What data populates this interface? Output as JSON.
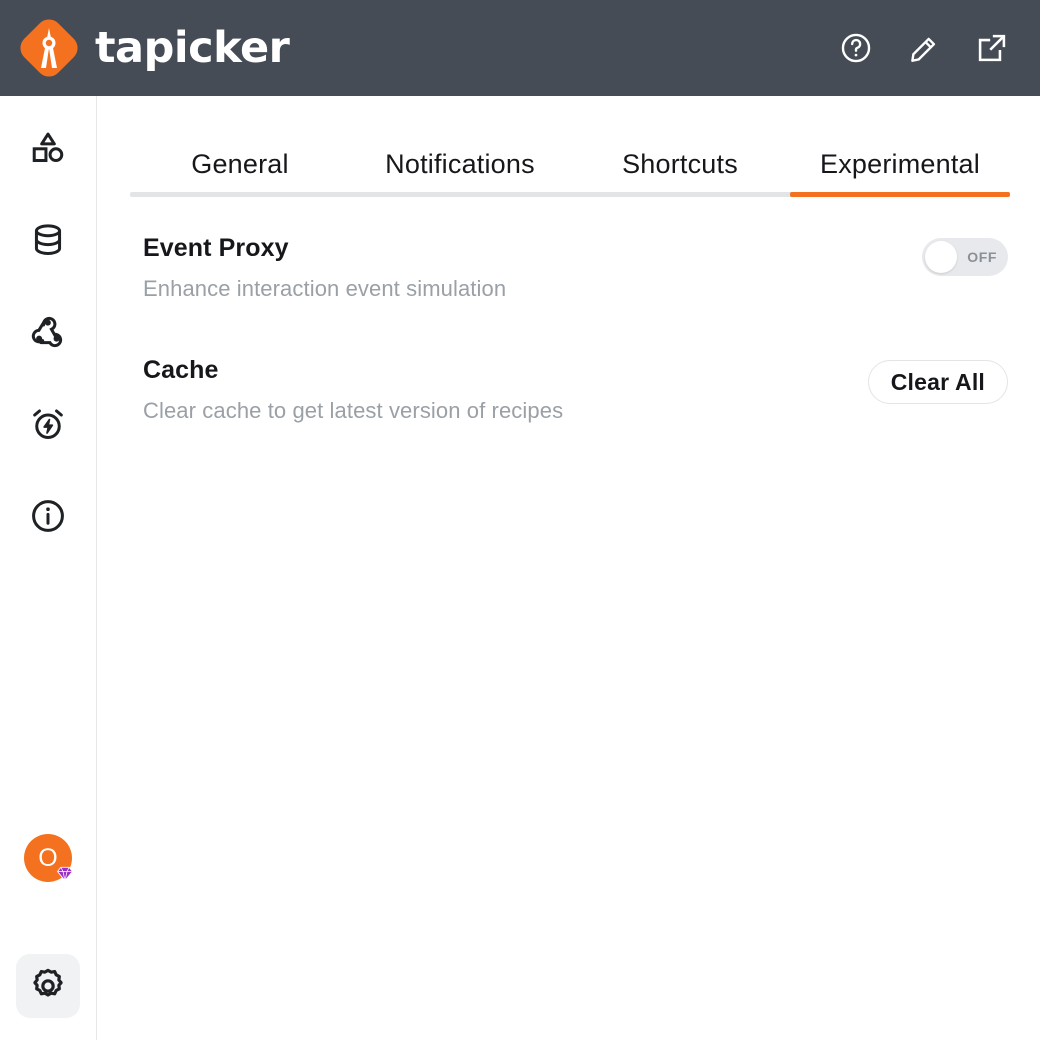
{
  "header": {
    "brand_name": "tapicker",
    "brand_color": "#f4711f",
    "background_color": "#454c55",
    "logo_icon": "tapicker-diamond-logo",
    "actions": [
      {
        "name": "help-icon",
        "label": "Help"
      },
      {
        "name": "edit-icon",
        "label": "Edit"
      },
      {
        "name": "external-link-icon",
        "label": "Open in new window"
      }
    ]
  },
  "sidebar": {
    "items": [
      {
        "name": "sidebar-item-recipes",
        "icon": "shapes-icon",
        "label": "Recipes",
        "active": false
      },
      {
        "name": "sidebar-item-data",
        "icon": "database-icon",
        "label": "Data",
        "active": false
      },
      {
        "name": "sidebar-item-webhooks",
        "icon": "webhook-icon",
        "label": "Webhooks",
        "active": false
      },
      {
        "name": "sidebar-item-schedules",
        "icon": "alarm-bolt-icon",
        "label": "Schedules",
        "active": false
      },
      {
        "name": "sidebar-item-info",
        "icon": "info-circle-icon",
        "label": "Info",
        "active": false
      }
    ],
    "account": {
      "name": "account-avatar",
      "initial": "O",
      "avatar_color": "#f4711f",
      "badge_icon": "gem-icon",
      "badge_color": "#9b2ec8"
    },
    "settings": {
      "name": "sidebar-item-settings",
      "icon": "gear-icon",
      "label": "Settings",
      "active": true,
      "active_background": "#f1f2f3"
    }
  },
  "main": {
    "tabs": [
      {
        "label": "General",
        "active": false
      },
      {
        "label": "Notifications",
        "active": false
      },
      {
        "label": "Shortcuts",
        "active": false
      },
      {
        "label": "Experimental",
        "active": true
      }
    ],
    "active_tab_color": "#f4711f",
    "tab_track_color": "#e2e4e6",
    "settings_rows": [
      {
        "title": "Event Proxy",
        "description": "Enhance interaction event simulation",
        "control": "toggle",
        "toggle_state": "OFF"
      },
      {
        "title": "Cache",
        "description": "Clear cache to get latest version of recipes",
        "control": "button",
        "button_label": "Clear All"
      }
    ]
  }
}
